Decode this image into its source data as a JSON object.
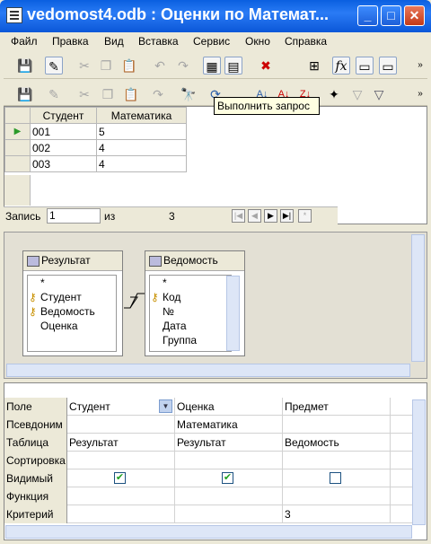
{
  "window": {
    "title": "vedomost4.odb : Оценки по Математ..."
  },
  "menu": [
    "Файл",
    "Правка",
    "Вид",
    "Вставка",
    "Сервис",
    "Окно",
    "Справка"
  ],
  "tooltip": "Выполнить запрос",
  "result": {
    "columns": [
      "Студент",
      "Математика"
    ],
    "rows": [
      [
        "001",
        "5"
      ],
      [
        "002",
        "4"
      ],
      [
        "003",
        "4"
      ]
    ]
  },
  "record": {
    "label": "Запись",
    "current": "1",
    "of_label": "из",
    "total": "3"
  },
  "tables": [
    {
      "name": "Результат",
      "fields": [
        "*",
        "Студент",
        "Ведомость",
        "Оценка"
      ]
    },
    {
      "name": "Ведомость",
      "fields": [
        "*",
        "Код",
        "№",
        "Дата",
        "Группа"
      ]
    }
  ],
  "query": {
    "row_labels": [
      "Поле",
      "Псевдоним",
      "Таблица",
      "Сортировка",
      "Видимый",
      "Функция",
      "Критерий"
    ],
    "columns": [
      {
        "field": "Студент",
        "alias": "",
        "table": "Результат",
        "visible": true,
        "criteria": ""
      },
      {
        "field": "Оценка",
        "alias": "Математика",
        "table": "Результат",
        "visible": true,
        "criteria": ""
      },
      {
        "field": "Предмет",
        "alias": "",
        "table": "Ведомость",
        "visible": false,
        "criteria": "3"
      }
    ]
  },
  "icons": [
    "save-icon",
    "edit-icon",
    "cut-icon",
    "copy-icon",
    "paste-icon",
    "undo-icon",
    "redo-icon",
    "query-icon",
    "design-icon",
    "delete-icon",
    "add-table-icon",
    "function-icon",
    "run-query-icon",
    "sort-ascending-icon",
    "sort-descending-icon",
    "autofilter-icon",
    "filter-icon"
  ]
}
